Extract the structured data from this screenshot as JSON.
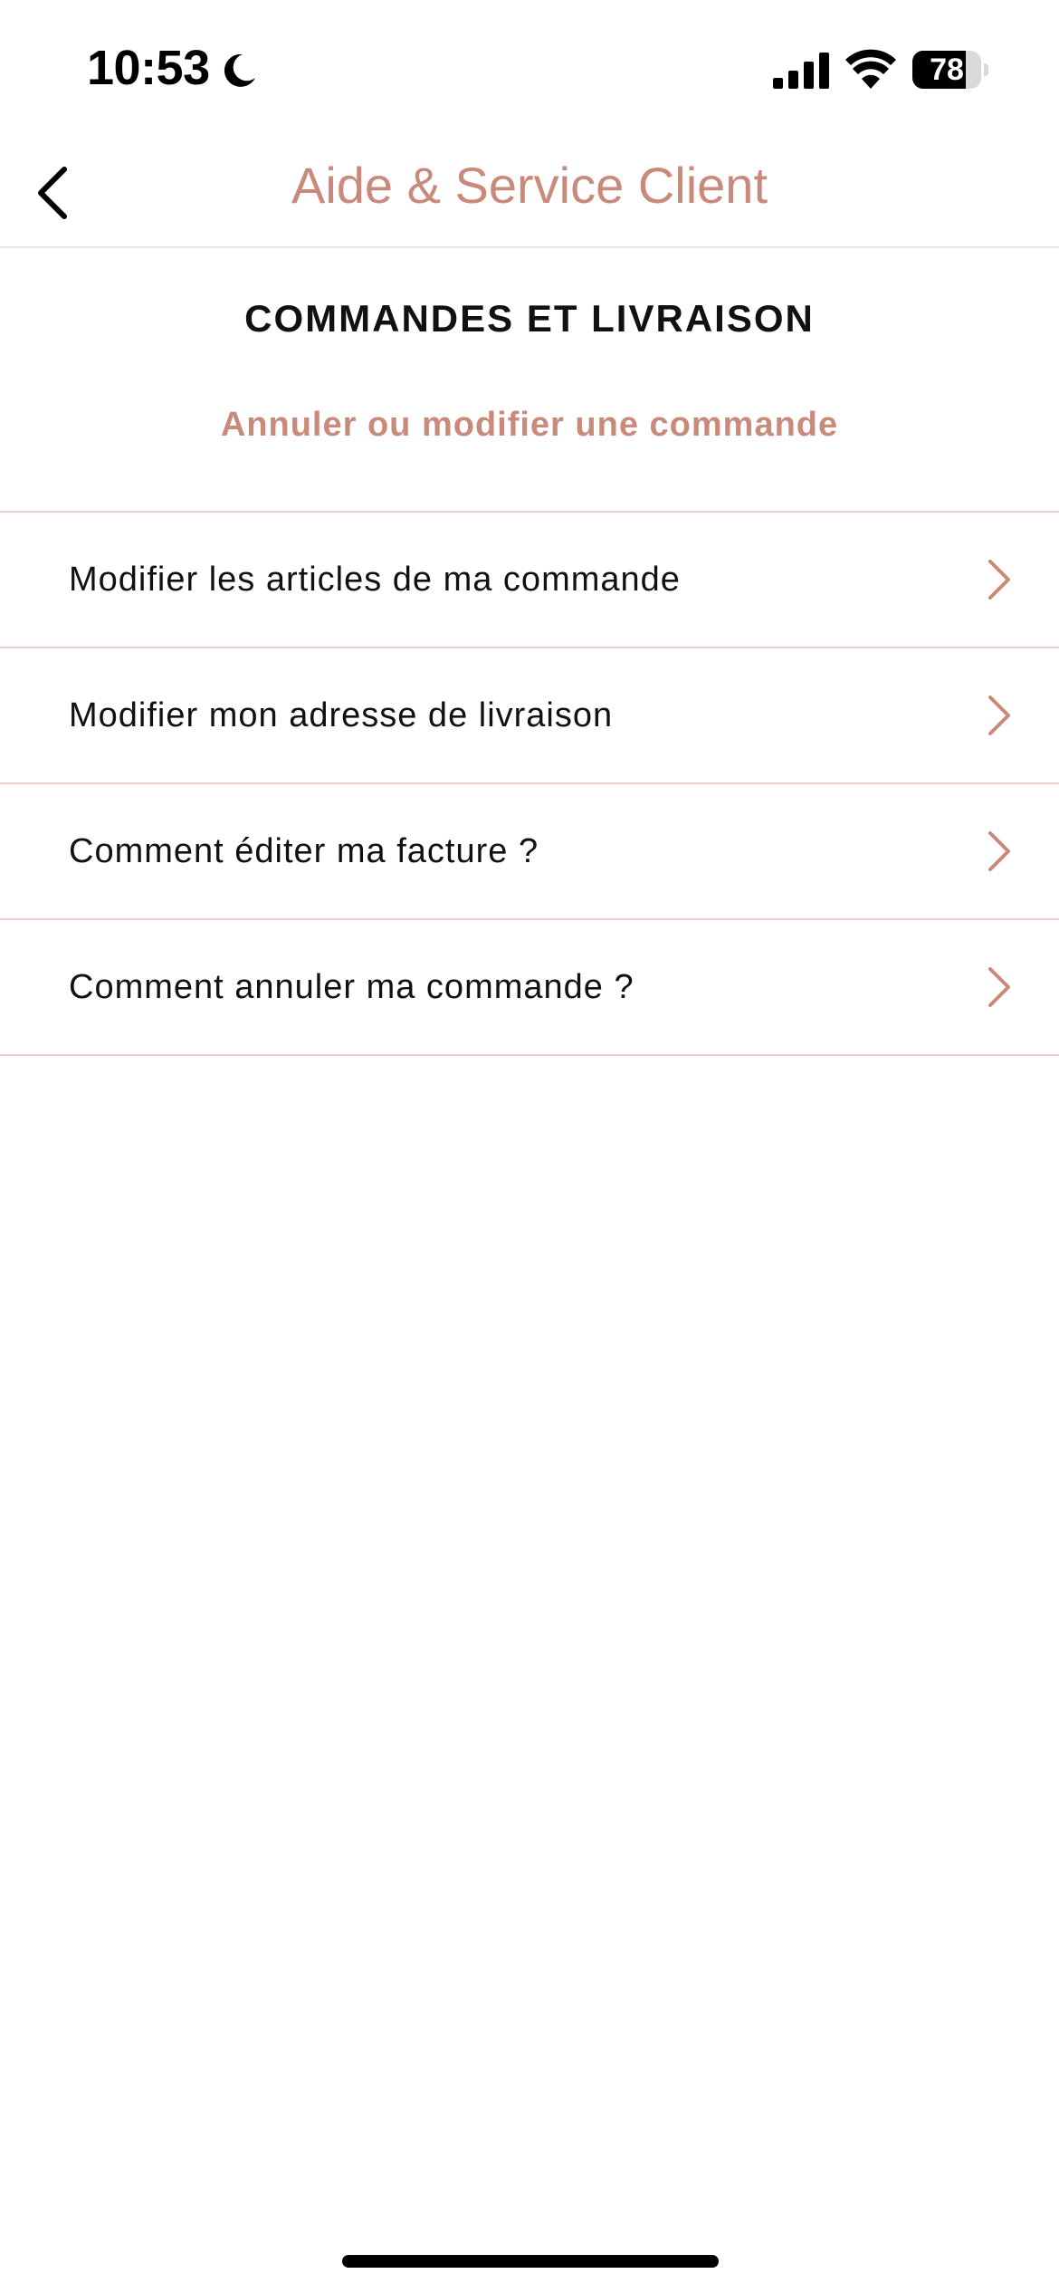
{
  "status_bar": {
    "time": "10:53",
    "battery_level": "78",
    "battery_percent": 78,
    "icons": [
      "moon-icon",
      "signal-icon",
      "wifi-icon",
      "battery-icon"
    ]
  },
  "nav": {
    "title": "Aide & Service Client",
    "back_icon": "chevron-left-icon"
  },
  "section": {
    "title": "COMMANDES ET LIVRAISON",
    "subtitle": "Annuler ou modifier une commande"
  },
  "items": [
    {
      "label": "Modifier les articles de ma commande"
    },
    {
      "label": "Modifier mon adresse de livraison"
    },
    {
      "label": "Comment éditer ma facture ?"
    },
    {
      "label": "Comment annuler ma commande ?"
    }
  ],
  "colors": {
    "accent": "#c98a7b",
    "divider": "#e8cfca",
    "text": "#111111",
    "background": "#ffffff"
  }
}
